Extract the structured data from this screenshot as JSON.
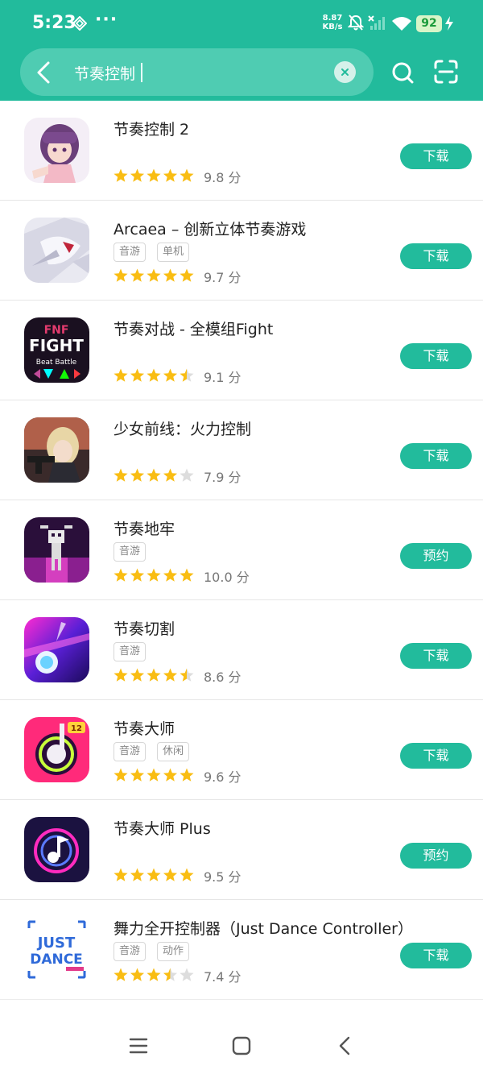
{
  "status_bar": {
    "time": "5:23",
    "more": "···",
    "net_speed_value": "8.87",
    "net_speed_unit": "KB/s",
    "battery": "92"
  },
  "search": {
    "query": "节奏控制"
  },
  "colors": {
    "accent": "#22bb9c",
    "star": "#f9bd13",
    "star_empty": "#dddddd"
  },
  "apps": [
    {
      "name": "节奏控制 2",
      "tags": [],
      "rating_text": "9.8 分",
      "rating": 5.0,
      "action": "下载",
      "icon": "anime-girl-icon"
    },
    {
      "name": "Arcaea – 创新立体节奏游戏",
      "tags": [
        "音游",
        "单机"
      ],
      "rating_text": "9.7 分",
      "rating": 5.0,
      "action": "下载",
      "icon": "arcaea-icon"
    },
    {
      "name": "节奏对战 - 全模组Fight",
      "tags": [],
      "rating_text": "9.1 分",
      "rating": 4.5,
      "action": "下载",
      "icon": "fnf-icon"
    },
    {
      "name": "少女前线：火力控制",
      "tags": [],
      "rating_text": "7.9 分",
      "rating": 4.0,
      "action": "下载",
      "icon": "girls-frontline-icon"
    },
    {
      "name": "节奏地牢",
      "tags": [
        "音游"
      ],
      "rating_text": "10.0 分",
      "rating": 5.0,
      "action": "预约",
      "icon": "crypt-icon"
    },
    {
      "name": "节奏切割",
      "tags": [
        "音游"
      ],
      "rating_text": "8.6 分",
      "rating": 4.5,
      "action": "下载",
      "icon": "rhythm-slash-icon"
    },
    {
      "name": "节奏大师",
      "tags": [
        "音游",
        "休闲"
      ],
      "rating_text": "9.6 分",
      "rating": 5.0,
      "action": "下载",
      "icon": "rhythm-master-icon"
    },
    {
      "name": "节奏大师 Plus",
      "tags": [],
      "rating_text": "9.5 分",
      "rating": 5.0,
      "action": "预约",
      "icon": "rhythm-master-plus-icon"
    },
    {
      "name": "舞力全开控制器（Just Dance Controller）",
      "tags": [
        "音游",
        "动作"
      ],
      "rating_text": "7.4 分",
      "rating": 3.5,
      "action": "下载",
      "icon": "just-dance-icon"
    }
  ],
  "icon_texts": {
    "fnf_top": "FNF",
    "fnf_sub": "Beat Battle",
    "rm_badge": "12",
    "jd_line1": "JUST",
    "jd_line2": "DANCE"
  },
  "nav": {
    "menu_icon": "menu-icon",
    "home_icon": "home-icon",
    "back_icon": "back-icon"
  }
}
